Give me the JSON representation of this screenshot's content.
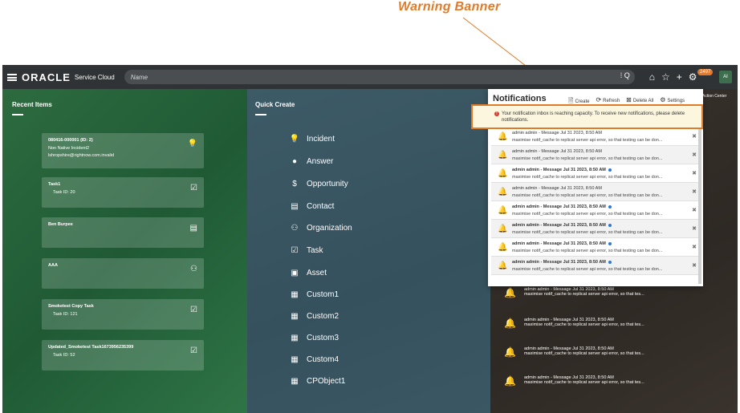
{
  "callout": {
    "label": "Warning Banner",
    "color": "#e07b2a"
  },
  "topbar": {
    "brand": "ORACLE",
    "product": "Service Cloud",
    "search_placeholder": "Name",
    "search_suffix": "⁞ Q",
    "badge": "2497",
    "avatar": "AI",
    "action_center": "Action Center"
  },
  "recent": {
    "title": "Recent Items",
    "cards": [
      {
        "title": "080416-000001 (ID: 2)",
        "lines": [
          "Non Native Incident2",
          "lshropshire@rightnow.com.invalid"
        ],
        "icon": "incident-icon"
      },
      {
        "title": "Task1",
        "lines": [
          "Task ID: 20"
        ],
        "icon": "task-icon"
      },
      {
        "title": "Ben Burpee",
        "lines": [],
        "icon": "contact-card-icon"
      },
      {
        "title": "AAA",
        "lines": [],
        "icon": "org-icon"
      },
      {
        "title": "Smoketest Copy Task",
        "lines": [
          "Task ID: 121"
        ],
        "icon": "task-icon"
      },
      {
        "title": "Updated_Smoketest Task1673956235399",
        "lines": [
          "Task ID: 52"
        ],
        "icon": "task-icon"
      }
    ]
  },
  "quick": {
    "title": "Quick Create",
    "items": [
      {
        "label": "Incident",
        "icon": "incident-icon"
      },
      {
        "label": "Answer",
        "icon": "lightbulb-icon"
      },
      {
        "label": "Opportunity",
        "icon": "opportunity-icon"
      },
      {
        "label": "Contact",
        "icon": "contact-card-icon"
      },
      {
        "label": "Organization",
        "icon": "org-icon"
      },
      {
        "label": "Task",
        "icon": "task-icon"
      },
      {
        "label": "Asset",
        "icon": "asset-icon"
      },
      {
        "label": "Custom1",
        "icon": "custom-icon"
      },
      {
        "label": "Custom2",
        "icon": "custom-icon"
      },
      {
        "label": "Custom3",
        "icon": "custom-icon"
      },
      {
        "label": "Custom4",
        "icon": "custom-icon"
      },
      {
        "label": "CPObject1",
        "icon": "custom-icon"
      }
    ]
  },
  "notifications": {
    "title": "Notifications",
    "actions": {
      "create": "Create",
      "refresh": "Refresh",
      "delete_all": "Delete All",
      "settings": "Settings"
    },
    "warning": "Your notification inbox is reaching capacity. To receive new notifications, please delete notifications.",
    "rows": [
      {
        "l1": "admin admin - Message Jul 31 2023, 8:50 AM",
        "l2": "maximise notif_cache to replicat server api error, so that testing can be don...",
        "bold": false
      },
      {
        "l1": "admin admin - Message Jul 31 2023, 8:50 AM",
        "l2": "maximise notif_cache to replicat server api error, so that testing can be don...",
        "bold": false
      },
      {
        "l1": "admin admin - Message Jul 31 2023, 8:50 AM",
        "l2": "maximise notif_cache to replicat server api error, so that testing can be don...",
        "bold": true
      },
      {
        "l1": "admin admin - Message Jul 31 2023, 8:50 AM",
        "l2": "maximise notif_cache to replicat server api error, so that testing can be don...",
        "bold": false
      },
      {
        "l1": "admin admin - Message Jul 31 2023, 8:50 AM",
        "l2": "maximise notif_cache to replicat server api error, so that testing can be don...",
        "bold": true
      },
      {
        "l1": "admin admin - Message Jul 31 2023, 8:50 AM",
        "l2": "maximise notif_cache to replicat server api error, so that testing can be don...",
        "bold": true
      },
      {
        "l1": "admin admin - Message Jul 31 2023, 8:50 AM",
        "l2": "maximise notif_cache to replicat server api error, so that testing can be don...",
        "bold": true
      },
      {
        "l1": "admin admin - Message Jul 31 2023, 8:50 AM",
        "l2": "maximise notif_cache to replicat server api error, so that testing can be don...",
        "bold": true
      }
    ],
    "bg_rows": [
      {
        "l1": "admin admin - Message Jul 31 2023, 8:50 AM",
        "l2": "maximise notif_cache to replicat server api error, so that tes..."
      },
      {
        "l1": "admin admin - Message Jul 31 2023, 8:50 AM",
        "l2": "maximise notif_cache to replicat server api error, so that tes..."
      },
      {
        "l1": "admin admin - Message Jul 31 2023, 8:50 AM",
        "l2": "maximise notif_cache to replicat server api error, so that tes..."
      },
      {
        "l1": "admin admin - Message Jul 31 2023, 8:50 AM",
        "l2": "maximise notif_cache to replicat server api error, so that tes..."
      }
    ]
  }
}
